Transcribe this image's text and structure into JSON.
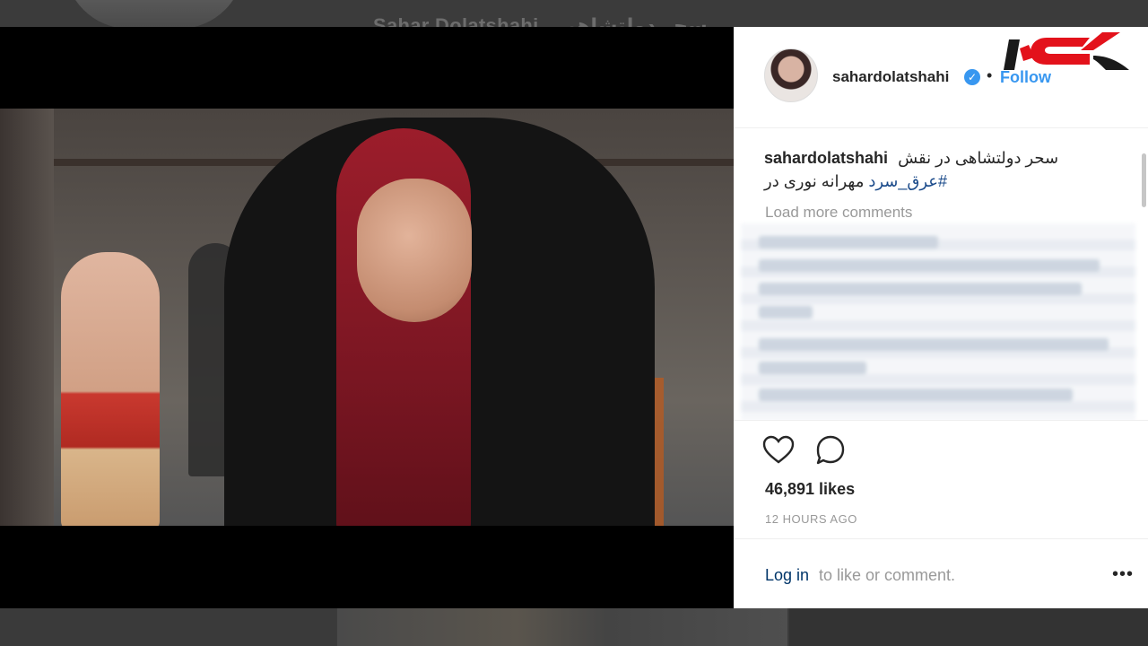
{
  "background_page": {
    "name_text": "Sahar Dolatshahi",
    "name_text_fa": "سحر دولتشاهی"
  },
  "post": {
    "username": "sahardolatshahi",
    "verified_icon": "verified-badge-icon",
    "separator": "•",
    "follow_label": "Follow",
    "caption_user": "sahardolatshahi",
    "caption_text_line1": "سحر دولتشاهی در نقش",
    "caption_text_line2": "مهرانه نوری در",
    "caption_hashtag": "#عرق_سرد",
    "load_more_label": "Load more comments",
    "likes": "46,891 likes",
    "timestamp": "12 HOURS AGO",
    "login_label": "Log in",
    "login_suffix": "to like or comment.",
    "more_label": "•••"
  },
  "icons": {
    "like": "heart-icon",
    "comment": "comment-bubble-icon",
    "more": "more-options-icon"
  },
  "colors": {
    "accent": "#3897f0",
    "link_dark": "#003569",
    "text": "#262626",
    "muted": "#999999",
    "logo_red": "#e3121b"
  }
}
